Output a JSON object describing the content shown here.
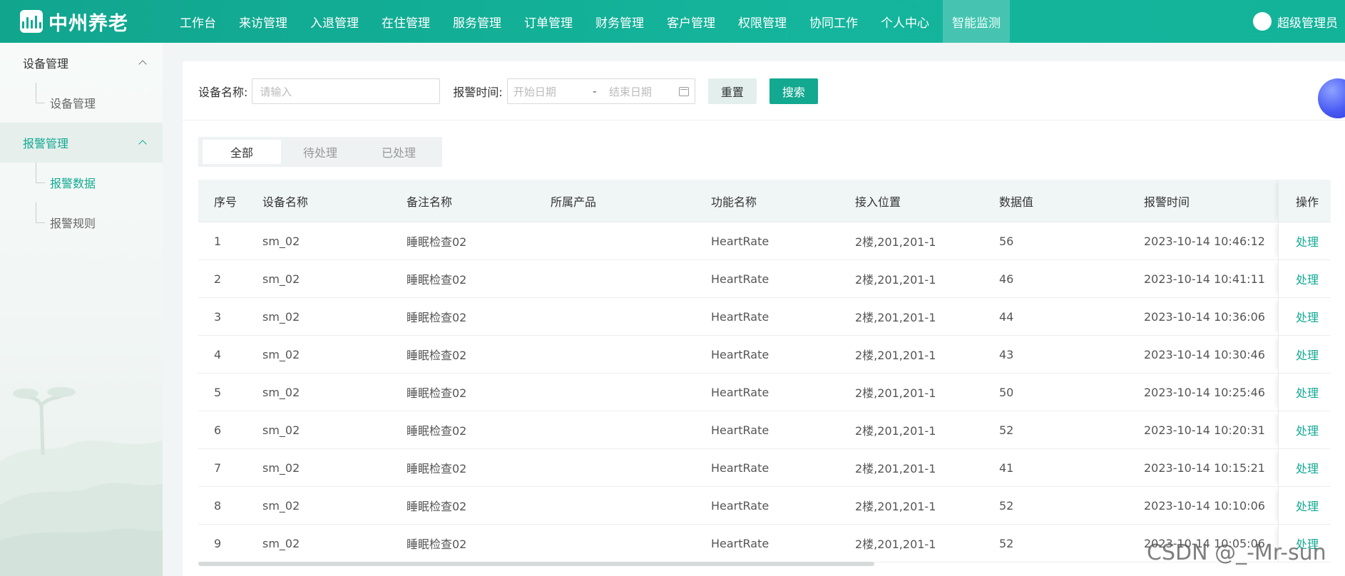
{
  "header": {
    "brand": "中州养老",
    "nav": [
      {
        "label": "工作台"
      },
      {
        "label": "来访管理"
      },
      {
        "label": "入退管理"
      },
      {
        "label": "在住管理"
      },
      {
        "label": "服务管理"
      },
      {
        "label": "订单管理"
      },
      {
        "label": "财务管理"
      },
      {
        "label": "客户管理"
      },
      {
        "label": "权限管理"
      },
      {
        "label": "协同工作"
      },
      {
        "label": "个人中心"
      },
      {
        "label": "智能监测",
        "active": true
      }
    ],
    "user": "超级管理员",
    "accent": "#13a890"
  },
  "sidebar": {
    "groups": [
      {
        "label": "设备管理",
        "items": [
          {
            "label": "设备管理"
          }
        ]
      },
      {
        "label": "报警管理",
        "active": true,
        "items": [
          {
            "label": "报警数据",
            "active": true
          },
          {
            "label": "报警规则"
          }
        ]
      }
    ]
  },
  "filters": {
    "device_name_label": "设备名称:",
    "device_name_placeholder": "请输入",
    "alarm_time_label": "报警时间:",
    "start_placeholder": "开始日期",
    "range_sep": "-",
    "end_placeholder": "结束日期",
    "reset": "重置",
    "search": "搜索"
  },
  "tabs": [
    {
      "label": "全部",
      "active": true
    },
    {
      "label": "待处理"
    },
    {
      "label": "已处理"
    }
  ],
  "table": {
    "columns": [
      "序号",
      "设备名称",
      "备注名称",
      "所属产品",
      "功能名称",
      "接入位置",
      "数据值",
      "报警时间",
      "操作"
    ],
    "action_label": "处理",
    "rows": [
      {
        "idx": "1",
        "device": "sm_02",
        "note": "睡眠检查02",
        "product": "",
        "func": "HeartRate",
        "pos": "2楼,201,201-1",
        "val": "56",
        "time": "2023-10-14 10:46:12"
      },
      {
        "idx": "2",
        "device": "sm_02",
        "note": "睡眠检查02",
        "product": "",
        "func": "HeartRate",
        "pos": "2楼,201,201-1",
        "val": "46",
        "time": "2023-10-14 10:41:11"
      },
      {
        "idx": "3",
        "device": "sm_02",
        "note": "睡眠检查02",
        "product": "",
        "func": "HeartRate",
        "pos": "2楼,201,201-1",
        "val": "44",
        "time": "2023-10-14 10:36:06"
      },
      {
        "idx": "4",
        "device": "sm_02",
        "note": "睡眠检查02",
        "product": "",
        "func": "HeartRate",
        "pos": "2楼,201,201-1",
        "val": "43",
        "time": "2023-10-14 10:30:46"
      },
      {
        "idx": "5",
        "device": "sm_02",
        "note": "睡眠检查02",
        "product": "",
        "func": "HeartRate",
        "pos": "2楼,201,201-1",
        "val": "50",
        "time": "2023-10-14 10:25:46"
      },
      {
        "idx": "6",
        "device": "sm_02",
        "note": "睡眠检查02",
        "product": "",
        "func": "HeartRate",
        "pos": "2楼,201,201-1",
        "val": "52",
        "time": "2023-10-14 10:20:31"
      },
      {
        "idx": "7",
        "device": "sm_02",
        "note": "睡眠检查02",
        "product": "",
        "func": "HeartRate",
        "pos": "2楼,201,201-1",
        "val": "41",
        "time": "2023-10-14 10:15:21"
      },
      {
        "idx": "8",
        "device": "sm_02",
        "note": "睡眠检查02",
        "product": "",
        "func": "HeartRate",
        "pos": "2楼,201,201-1",
        "val": "52",
        "time": "2023-10-14 10:10:06"
      },
      {
        "idx": "9",
        "device": "sm_02",
        "note": "睡眠检查02",
        "product": "",
        "func": "HeartRate",
        "pos": "2楼,201,201-1",
        "val": "52",
        "time": "2023-10-14 10:05:06"
      }
    ]
  },
  "watermark": "CSDN @_-Mr-sun"
}
